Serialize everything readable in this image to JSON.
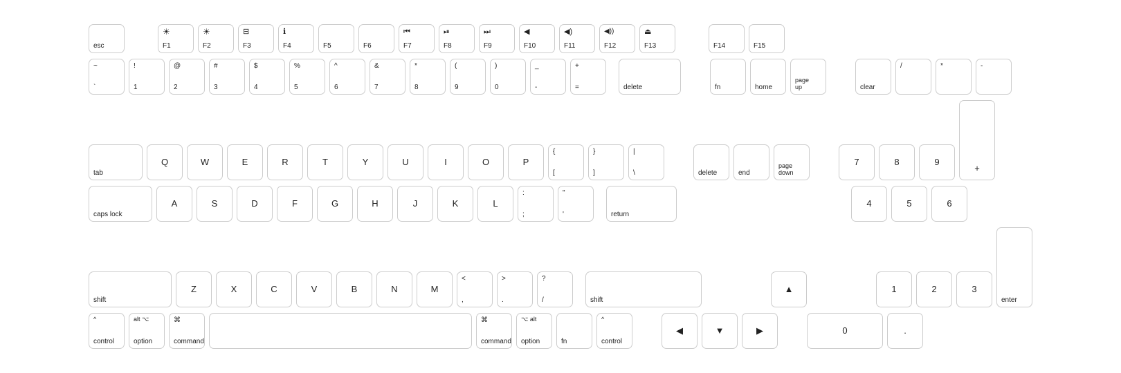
{
  "keyboard": {
    "rows": [
      {
        "id": "function-row",
        "keys": [
          {
            "id": "esc",
            "labels": [
              "esc"
            ],
            "width": "w1",
            "type": "bottom"
          },
          {
            "id": "gap1",
            "labels": [],
            "width": "w1",
            "type": "gap"
          },
          {
            "id": "f1",
            "labels": [
              "☀",
              "F1"
            ],
            "width": "w1",
            "type": "icon-fn"
          },
          {
            "id": "f2",
            "labels": [
              "☀",
              "F2"
            ],
            "width": "w1",
            "type": "icon-fn"
          },
          {
            "id": "f3",
            "labels": [
              "⊞",
              "F3"
            ],
            "width": "w1",
            "type": "icon-fn"
          },
          {
            "id": "f4",
            "labels": [
              "ℹ",
              "F4"
            ],
            "width": "w1",
            "type": "icon-fn"
          },
          {
            "id": "f5",
            "labels": [
              "F5"
            ],
            "width": "w1",
            "type": "fn-only"
          },
          {
            "id": "f6",
            "labels": [
              "F6"
            ],
            "width": "w1",
            "type": "fn-only"
          },
          {
            "id": "f7",
            "labels": [
              "⏮",
              "F7"
            ],
            "width": "w1",
            "type": "icon-fn"
          },
          {
            "id": "f8",
            "labels": [
              "⏯",
              "F8"
            ],
            "width": "w1",
            "type": "icon-fn"
          },
          {
            "id": "f9",
            "labels": [
              "⏭",
              "F9"
            ],
            "width": "w1",
            "type": "icon-fn"
          },
          {
            "id": "f10",
            "labels": [
              "🔇",
              "F10"
            ],
            "width": "w1",
            "type": "icon-fn"
          },
          {
            "id": "f11",
            "labels": [
              "🔉",
              "F11"
            ],
            "width": "w1",
            "type": "icon-fn"
          },
          {
            "id": "f12",
            "labels": [
              "🔊",
              "F12"
            ],
            "width": "w1",
            "type": "icon-fn"
          },
          {
            "id": "f13",
            "labels": [
              "⏏",
              "F13"
            ],
            "width": "w1",
            "type": "icon-fn"
          },
          {
            "id": "gap2",
            "labels": [],
            "width": "w1",
            "type": "gap"
          },
          {
            "id": "f14",
            "labels": [
              "F14"
            ],
            "width": "w1",
            "type": "fn-only"
          },
          {
            "id": "f15",
            "labels": [
              "F15"
            ],
            "width": "w1",
            "type": "fn-only"
          }
        ]
      }
    ]
  }
}
